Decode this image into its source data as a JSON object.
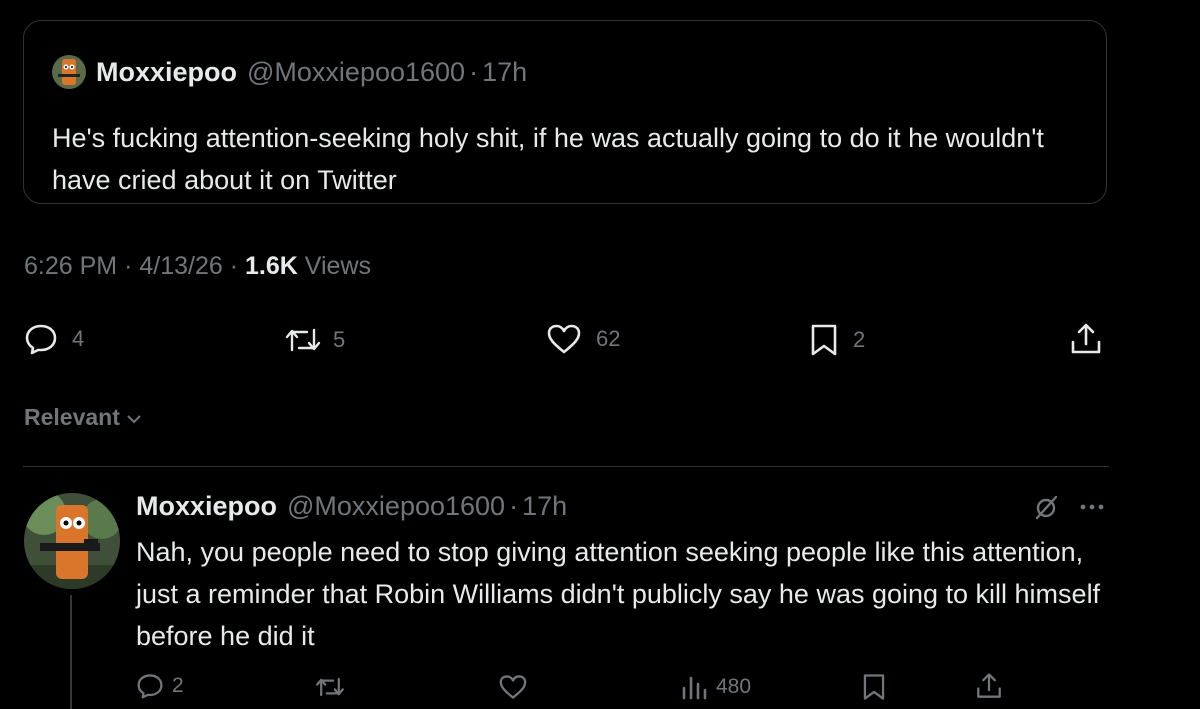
{
  "quoted_tweet": {
    "display_name": "Moxxiepoo",
    "handle": "@Moxxiepoo1600",
    "time": "17h",
    "text": "He's fucking attention-seeking holy shit, if he was actually going to do it he wouldn't have cried about it on Twitter"
  },
  "meta": {
    "time": "6:26 PM",
    "date": "4/13/26",
    "views_count": "1.6K",
    "views_label": "Views"
  },
  "actions": {
    "replies": "4",
    "reposts": "5",
    "likes": "62",
    "bookmarks": "2"
  },
  "sort": {
    "label": "Relevant"
  },
  "reply_tweet": {
    "display_name": "Moxxiepoo",
    "handle": "@Moxxiepoo1600",
    "time": "17h",
    "text": "Nah, you people need to stop giving attention seeking people like this attention, just a reminder that Robin Williams didn't publicly say he was going to kill himself before he did it",
    "replies": "2",
    "views": "480"
  },
  "separator": "·",
  "colors": {
    "background": "#000000",
    "text": "#e7e9ea",
    "muted": "#71767b",
    "border": "#2f3336"
  }
}
